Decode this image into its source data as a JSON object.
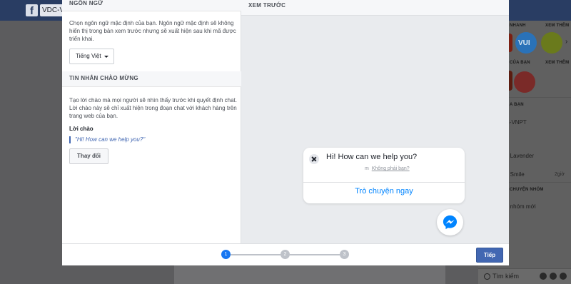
{
  "background": {
    "page_name": "VDC-V",
    "sections": {
      "games_header": "NHANH",
      "see_more_1": "XEM THÊM",
      "your_games": "CỦA BẠN",
      "see_more_2": "XEM THÊM",
      "header_3": "A BẠN",
      "contacts": [
        "C-VNPT",
        "e Lavender",
        "g Smile"
      ],
      "time": "2giờ",
      "group_header": "CHUYỆN NHÓM",
      "new_group": "o nhóm mới",
      "game_label": "VUI"
    },
    "search_placeholder": "Tìm kiếm"
  },
  "modal": {
    "language_section": {
      "title": "NGÔN NGỮ",
      "description": "Chọn ngôn ngữ mặc định của bạn. Ngôn ngữ mặc định sẽ không hiển thị trong bản xem trước nhưng sẽ xuất hiện sau khi mã được triển khai.",
      "selected_language": "Tiếng Việt"
    },
    "greeting_section": {
      "title": "TIN NHẮN CHÀO MỪNG",
      "description": "Tạo lời chào mà mọi người sẽ nhìn thấy trước khi quyết định chat. Lời chào này sẽ chỉ xuất hiện trong đoạn chat với khách hàng trên trang web của bạn.",
      "label": "Lời chào",
      "value": "\"Hi! How can we help you?\"",
      "change_button": "Thay đổi"
    },
    "preview": {
      "title": "XEM TRƯỚC",
      "greeting": "Hi! How can we help you?",
      "not_you_prefix": "m",
      "not_you_link": "Không phải bạn?",
      "chat_now": "Trò chuyện ngay"
    },
    "footer": {
      "steps": [
        "1",
        "2",
        "3"
      ],
      "active_step": 1,
      "next_button": "Tiếp"
    }
  },
  "colors": {
    "accent": "#4267b2",
    "messenger_blue": "#0084ff",
    "step_active": "#1877f2"
  }
}
